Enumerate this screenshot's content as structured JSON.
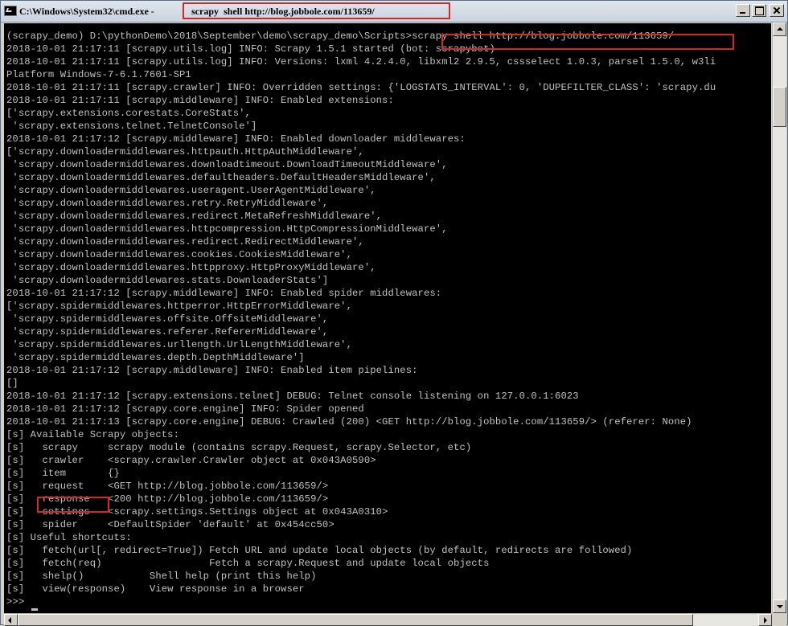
{
  "window": {
    "title": "C:\\Windows\\System32\\cmd.exe - ",
    "title_command": "scrapy  shell http://blog.jobbole.com/113659/"
  },
  "console": {
    "lines": [
      "(scrapy_demo) D:\\pythonDemo\\2018\\September\\demo\\scrapy_demo\\Scripts>scrapy shell http://blog.jobbole.com/113659/",
      "2018-10-01 21:17:11 [scrapy.utils.log] INFO: Scrapy 1.5.1 started (bot: scrapybot)",
      "2018-10-01 21:17:11 [scrapy.utils.log] INFO: Versions: lxml 4.2.4.0, libxml2 2.9.5, cssselect 1.0.3, parsel 1.5.0, w3li",
      "Platform Windows-7-6.1.7601-SP1",
      "2018-10-01 21:17:11 [scrapy.crawler] INFO: Overridden settings: {'LOGSTATS_INTERVAL': 0, 'DUPEFILTER_CLASS': 'scrapy.du",
      "2018-10-01 21:17:11 [scrapy.middleware] INFO: Enabled extensions:",
      "['scrapy.extensions.corestats.CoreStats',",
      " 'scrapy.extensions.telnet.TelnetConsole']",
      "2018-10-01 21:17:12 [scrapy.middleware] INFO: Enabled downloader middlewares:",
      "['scrapy.downloadermiddlewares.httpauth.HttpAuthMiddleware',",
      " 'scrapy.downloadermiddlewares.downloadtimeout.DownloadTimeoutMiddleware',",
      " 'scrapy.downloadermiddlewares.defaultheaders.DefaultHeadersMiddleware',",
      " 'scrapy.downloadermiddlewares.useragent.UserAgentMiddleware',",
      " 'scrapy.downloadermiddlewares.retry.RetryMiddleware',",
      " 'scrapy.downloadermiddlewares.redirect.MetaRefreshMiddleware',",
      " 'scrapy.downloadermiddlewares.httpcompression.HttpCompressionMiddleware',",
      " 'scrapy.downloadermiddlewares.redirect.RedirectMiddleware',",
      " 'scrapy.downloadermiddlewares.cookies.CookiesMiddleware',",
      " 'scrapy.downloadermiddlewares.httpproxy.HttpProxyMiddleware',",
      " 'scrapy.downloadermiddlewares.stats.DownloaderStats']",
      "2018-10-01 21:17:12 [scrapy.middleware] INFO: Enabled spider middlewares:",
      "['scrapy.spidermiddlewares.httperror.HttpErrorMiddleware',",
      " 'scrapy.spidermiddlewares.offsite.OffsiteMiddleware',",
      " 'scrapy.spidermiddlewares.referer.RefererMiddleware',",
      " 'scrapy.spidermiddlewares.urllength.UrlLengthMiddleware',",
      " 'scrapy.spidermiddlewares.depth.DepthMiddleware']",
      "2018-10-01 21:17:12 [scrapy.middleware] INFO: Enabled item pipelines:",
      "[]",
      "2018-10-01 21:17:12 [scrapy.extensions.telnet] DEBUG: Telnet console listening on 127.0.0.1:6023",
      "2018-10-01 21:17:12 [scrapy.core.engine] INFO: Spider opened",
      "2018-10-01 21:17:13 [scrapy.core.engine] DEBUG: Crawled (200) <GET http://blog.jobbole.com/113659/> (referer: None)",
      "[s] Available Scrapy objects:",
      "[s]   scrapy     scrapy module (contains scrapy.Request, scrapy.Selector, etc)",
      "[s]   crawler    <scrapy.crawler.Crawler object at 0x043A0590>",
      "[s]   item       {}",
      "[s]   request    <GET http://blog.jobbole.com/113659/>",
      "[s]   response   <200 http://blog.jobbole.com/113659/>",
      "[s]   settings   <scrapy.settings.Settings object at 0x043A0310>",
      "[s]   spider     <DefaultSpider 'default' at 0x454cc50>",
      "[s] Useful shortcuts:",
      "[s]   fetch(url[, redirect=True]) Fetch URL and update local objects (by default, redirects are followed)",
      "[s]   fetch(req)                  Fetch a scrapy.Request and update local objects",
      "[s]   shelp()           Shell help (print this help)",
      "[s]   view(response)    View response in a browser",
      ">>>"
    ]
  },
  "colors": {
    "console_background": "#000000",
    "console_text": "#c0c0c0",
    "highlight_box": "#d42828"
  }
}
